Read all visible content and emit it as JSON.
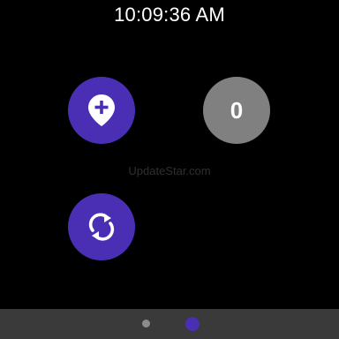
{
  "status": {
    "time": "10:09:36 AM"
  },
  "buttons": {
    "add_location": {
      "icon": "add-location-icon"
    },
    "counter": {
      "value": "0"
    },
    "sync": {
      "icon": "sync-icon"
    }
  },
  "watermark": {
    "text": "UpdateStar.com"
  },
  "page_indicator": {
    "pages": 2,
    "active_page": 2
  },
  "colors": {
    "accent": "#4a2fb4",
    "neutral_button": "#808080",
    "bottom_bar": "#3a3a3a"
  }
}
